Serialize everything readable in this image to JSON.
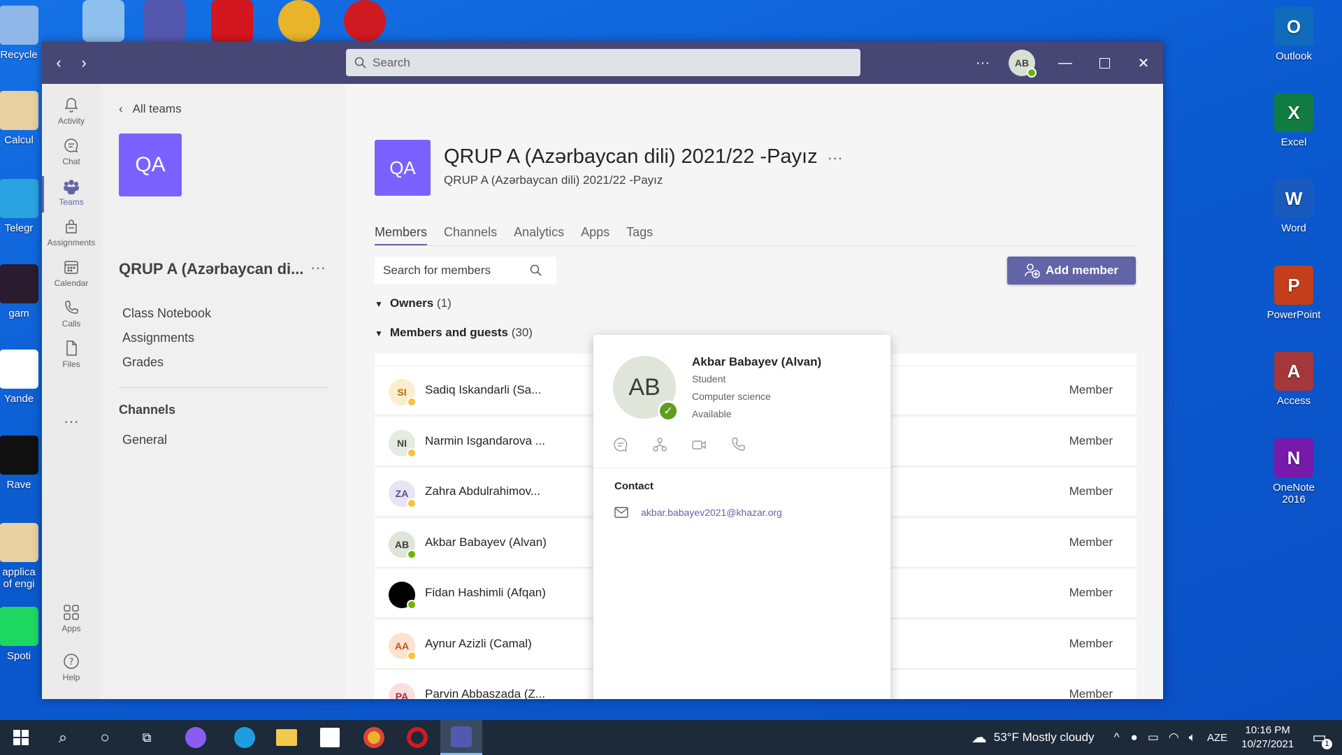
{
  "desktop": {
    "left_icons": [
      {
        "label": "Recycle",
        "icon": "recycle-bin-icon",
        "color": "#8fb8e8"
      },
      {
        "label": "Calcul",
        "icon": "document-icon",
        "color": "#e8d0a0"
      },
      {
        "label": "Telegr",
        "icon": "telegram-icon",
        "color": "#2aa3e0"
      },
      {
        "label": "gam",
        "icon": "game-icon",
        "color": "#2a1b2e"
      },
      {
        "label": "Yande",
        "icon": "yandex-icon",
        "color": "#ffffff"
      },
      {
        "label": "Rave",
        "icon": "rave-icon",
        "color": "#111111"
      },
      {
        "label": "applica\nof engi",
        "icon": "document-icon",
        "color": "#e8d0a0"
      },
      {
        "label": "Spoti",
        "icon": "spotify-icon",
        "color": "#1ed760"
      }
    ],
    "right_icons": [
      {
        "label": "Outlook",
        "letter": "O",
        "icon": "outlook-icon",
        "color": "#0f6cbd"
      },
      {
        "label": "Excel",
        "letter": "X",
        "icon": "excel-icon",
        "color": "#107c41"
      },
      {
        "label": "Word",
        "letter": "W",
        "icon": "word-icon",
        "color": "#185abd"
      },
      {
        "label": "PowerPoint",
        "letter": "P",
        "icon": "powerpoint-icon",
        "color": "#c43e1c"
      },
      {
        "label": "Access",
        "letter": "A",
        "icon": "access-icon",
        "color": "#a4373a"
      },
      {
        "label": "OneNote\n2016",
        "letter": "N",
        "icon": "onenote-icon",
        "color": "#7719aa"
      }
    ]
  },
  "titlebar": {
    "search_placeholder": "Search",
    "user_initials": "AB"
  },
  "rail": {
    "items": [
      {
        "label": "Activity",
        "icon": "bell-icon"
      },
      {
        "label": "Chat",
        "icon": "chat-icon"
      },
      {
        "label": "Teams",
        "icon": "teams-icon"
      },
      {
        "label": "Assignments",
        "icon": "assignments-icon"
      },
      {
        "label": "Calendar",
        "icon": "calendar-icon"
      },
      {
        "label": "Calls",
        "icon": "phone-icon"
      },
      {
        "label": "Files",
        "icon": "file-icon"
      }
    ],
    "more": "···",
    "apps": "Apps",
    "help": "Help"
  },
  "teampane": {
    "all_teams": "All teams",
    "initials": "QA",
    "team_name": "QRUP A (Azərbaycan di...",
    "links": [
      "Class Notebook",
      "Assignments",
      "Grades"
    ],
    "channels_heading": "Channels",
    "channels": [
      "General"
    ]
  },
  "main": {
    "initials": "QA",
    "title": "QRUP A (Azərbaycan dili) 2021/22 -Payız",
    "subtitle": "QRUP A (Azərbaycan dili) 2021/22 -Payız",
    "tabs": [
      "Members",
      "Channels",
      "Analytics",
      "Apps",
      "Tags"
    ],
    "member_search_placeholder": "Search for members",
    "add_member": "Add member",
    "owners_label": "Owners",
    "owners_count": "(1)",
    "members_label": "Members and guests",
    "members_count": "(30)",
    "members": [
      {
        "initials": "SI",
        "name": "Sadiq Iskandarli (Sa...",
        "role": "Member",
        "bg": "#fbeed0",
        "fg": "#b06f00",
        "presence": "away"
      },
      {
        "initials": "NI",
        "name": "Narmin Isgandarova ...",
        "role": "Member",
        "bg": "#e6ebe2",
        "fg": "#3c4d36",
        "presence": "away"
      },
      {
        "initials": "ZA",
        "name": "Zahra Abdulrahimov...",
        "role": "Member",
        "bg": "#e8e4f3",
        "fg": "#5a4b8c",
        "presence": "away"
      },
      {
        "initials": "AB",
        "name": "Akbar Babayev (Alvan)",
        "role": "Member",
        "bg": "#dfe5d8",
        "fg": "#3c3c3c",
        "presence": "available"
      },
      {
        "initials": "",
        "name": "Fidan Hashimli (Afqan)",
        "role": "Member",
        "bg": "#000000",
        "fg": "#ffffff",
        "presence": "available"
      },
      {
        "initials": "AA",
        "name": "Aynur Azizli (Camal)",
        "role": "Member",
        "bg": "#fbe3cf",
        "fg": "#b55a1a",
        "presence": "away"
      },
      {
        "initials": "PA",
        "name": "Parvin Abbaszada (Z...",
        "role": "Member",
        "bg": "#fbdfe0",
        "fg": "#a3303b",
        "presence": "away"
      }
    ]
  },
  "card": {
    "initials": "AB",
    "name": "Akbar Babayev (Alvan)",
    "title": "Student",
    "department": "Computer science",
    "status": "Available",
    "contact_heading": "Contact",
    "email": "akbar.babayev2021@khazar.org"
  },
  "taskbar": {
    "weather": "53°F  Mostly cloudy",
    "language": "AZE",
    "time": "10:16 PM",
    "date": "10/27/2021",
    "notifications": "1"
  }
}
